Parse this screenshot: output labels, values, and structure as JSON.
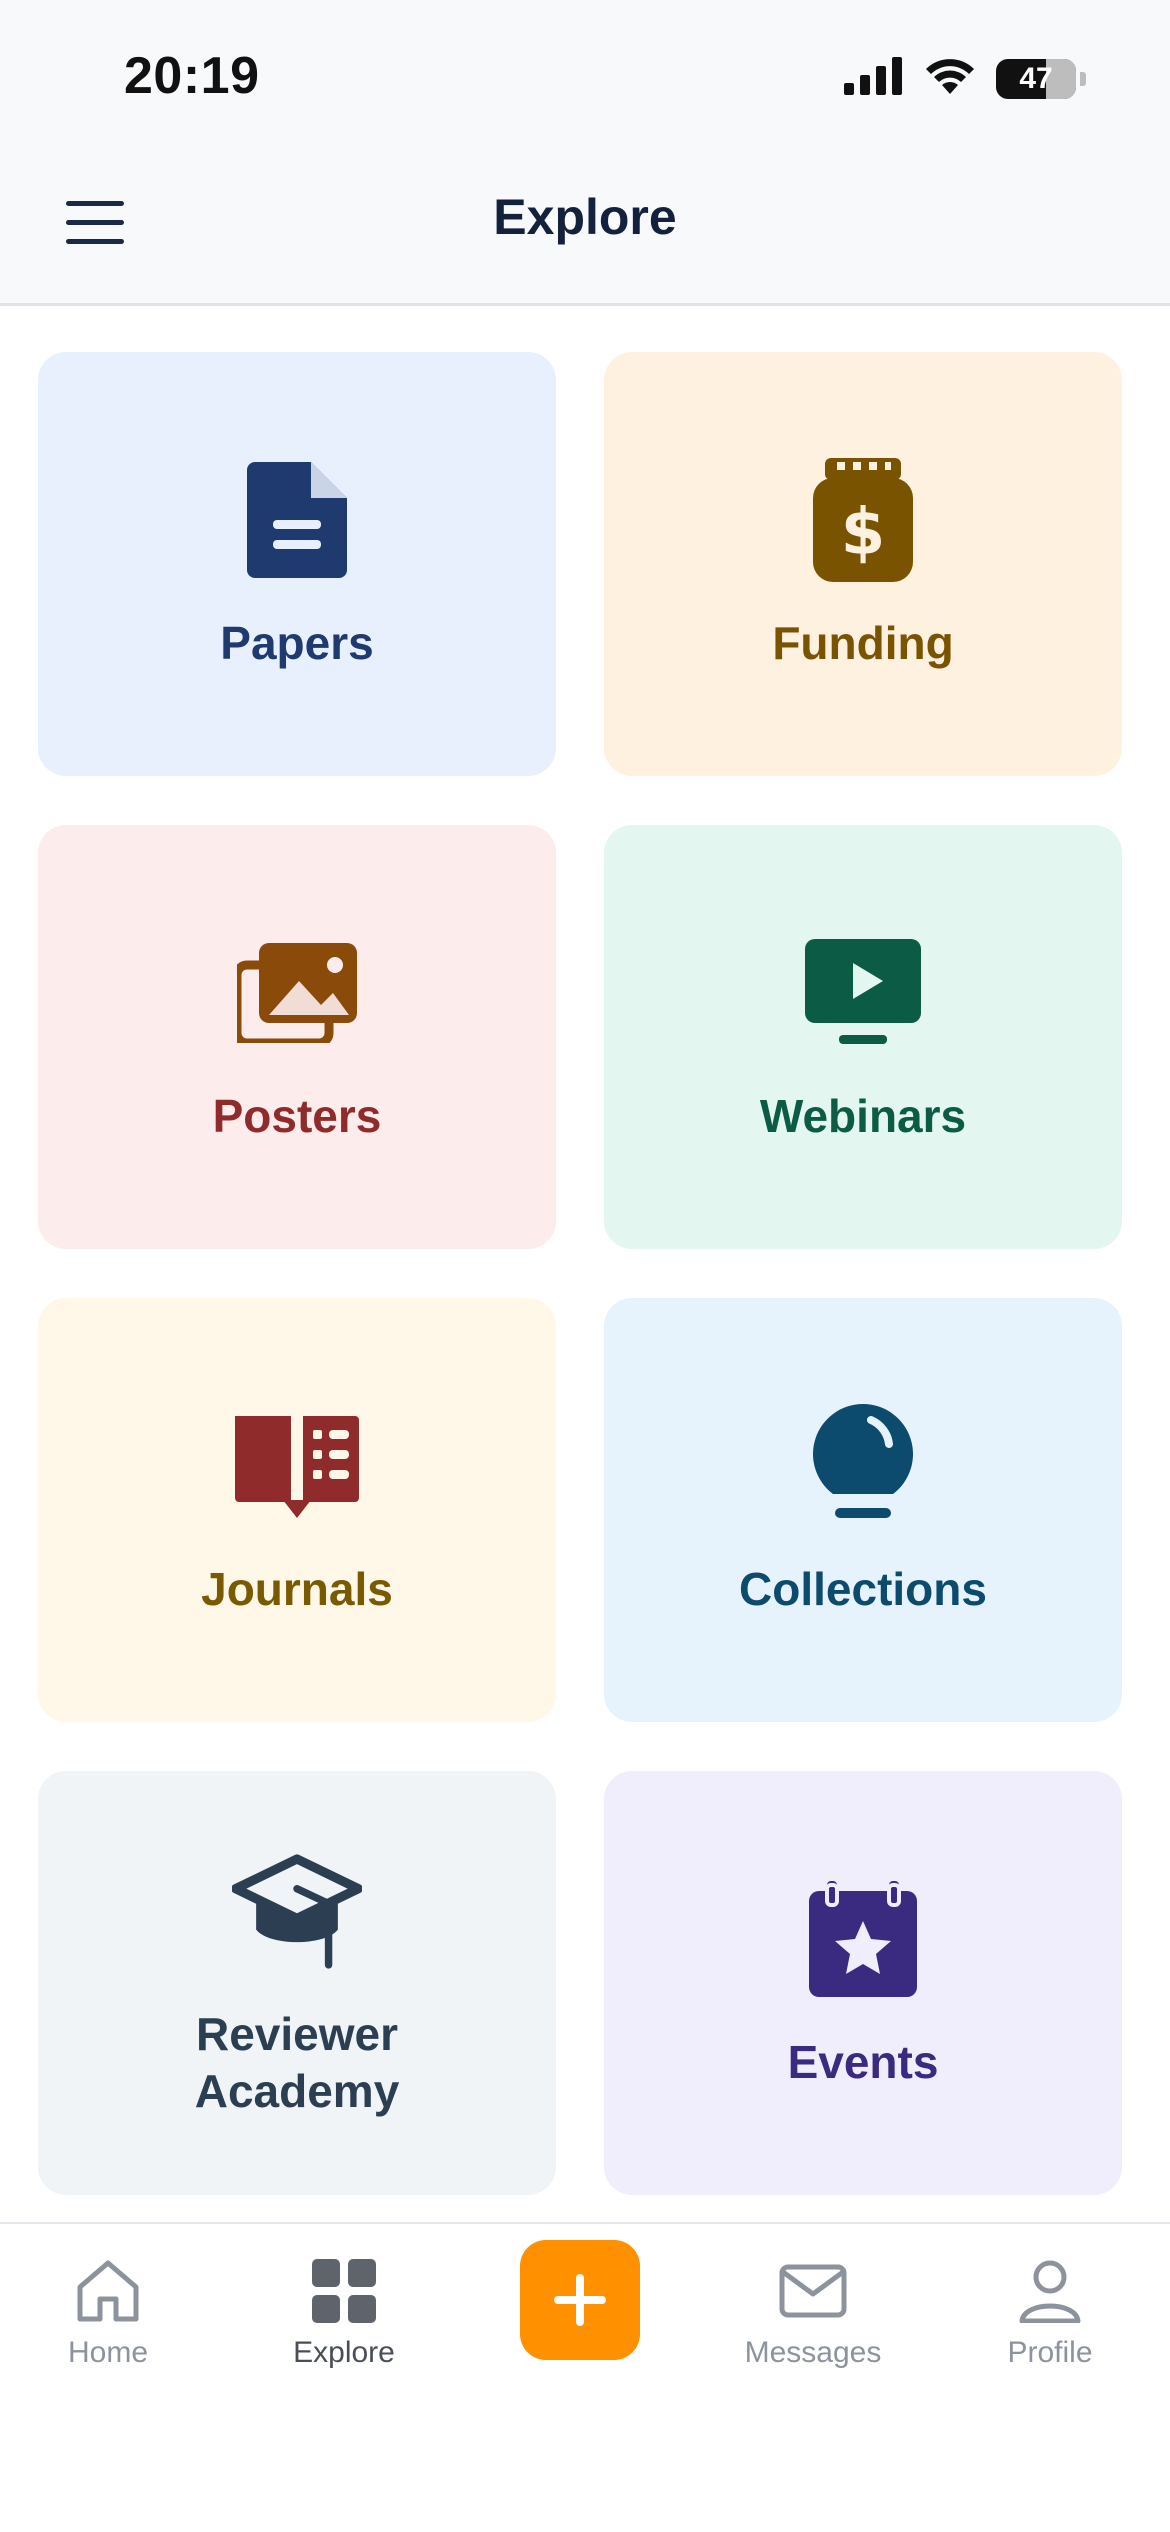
{
  "status_bar": {
    "time": "20:19",
    "battery": "47"
  },
  "header": {
    "title": "Explore"
  },
  "tiles": [
    {
      "label": "Papers",
      "icon": "document-icon",
      "bg": "#e8f0fd",
      "fg": "#1e3a6e"
    },
    {
      "label": "Funding",
      "icon": "money-bag-icon",
      "bg": "#fef1e0",
      "fg": "#7a5300"
    },
    {
      "label": "Posters",
      "icon": "images-icon",
      "bg": "#fdecec",
      "fg": "#8f2b2b"
    },
    {
      "label": "Webinars",
      "icon": "monitor-play-icon",
      "bg": "#e3f6ef",
      "fg": "#0c5b45"
    },
    {
      "label": "Journals",
      "icon": "open-book-icon",
      "bg": "#fff8e8",
      "fg": "#7a5a00"
    },
    {
      "label": "Collections",
      "icon": "lightbulb-icon",
      "bg": "#e6f3fc",
      "fg": "#0c4a6e"
    },
    {
      "label": "Reviewer\nAcademy",
      "icon": "graduation-cap-icon",
      "bg": "#f0f4f7",
      "fg": "#2c3e52"
    },
    {
      "label": "Events",
      "icon": "calendar-star-icon",
      "bg": "#f0eefc",
      "fg": "#3a2a80"
    }
  ],
  "tab_bar": {
    "home": "Home",
    "explore": "Explore",
    "messages": "Messages",
    "profile": "Profile",
    "accent": "#ff9100"
  }
}
